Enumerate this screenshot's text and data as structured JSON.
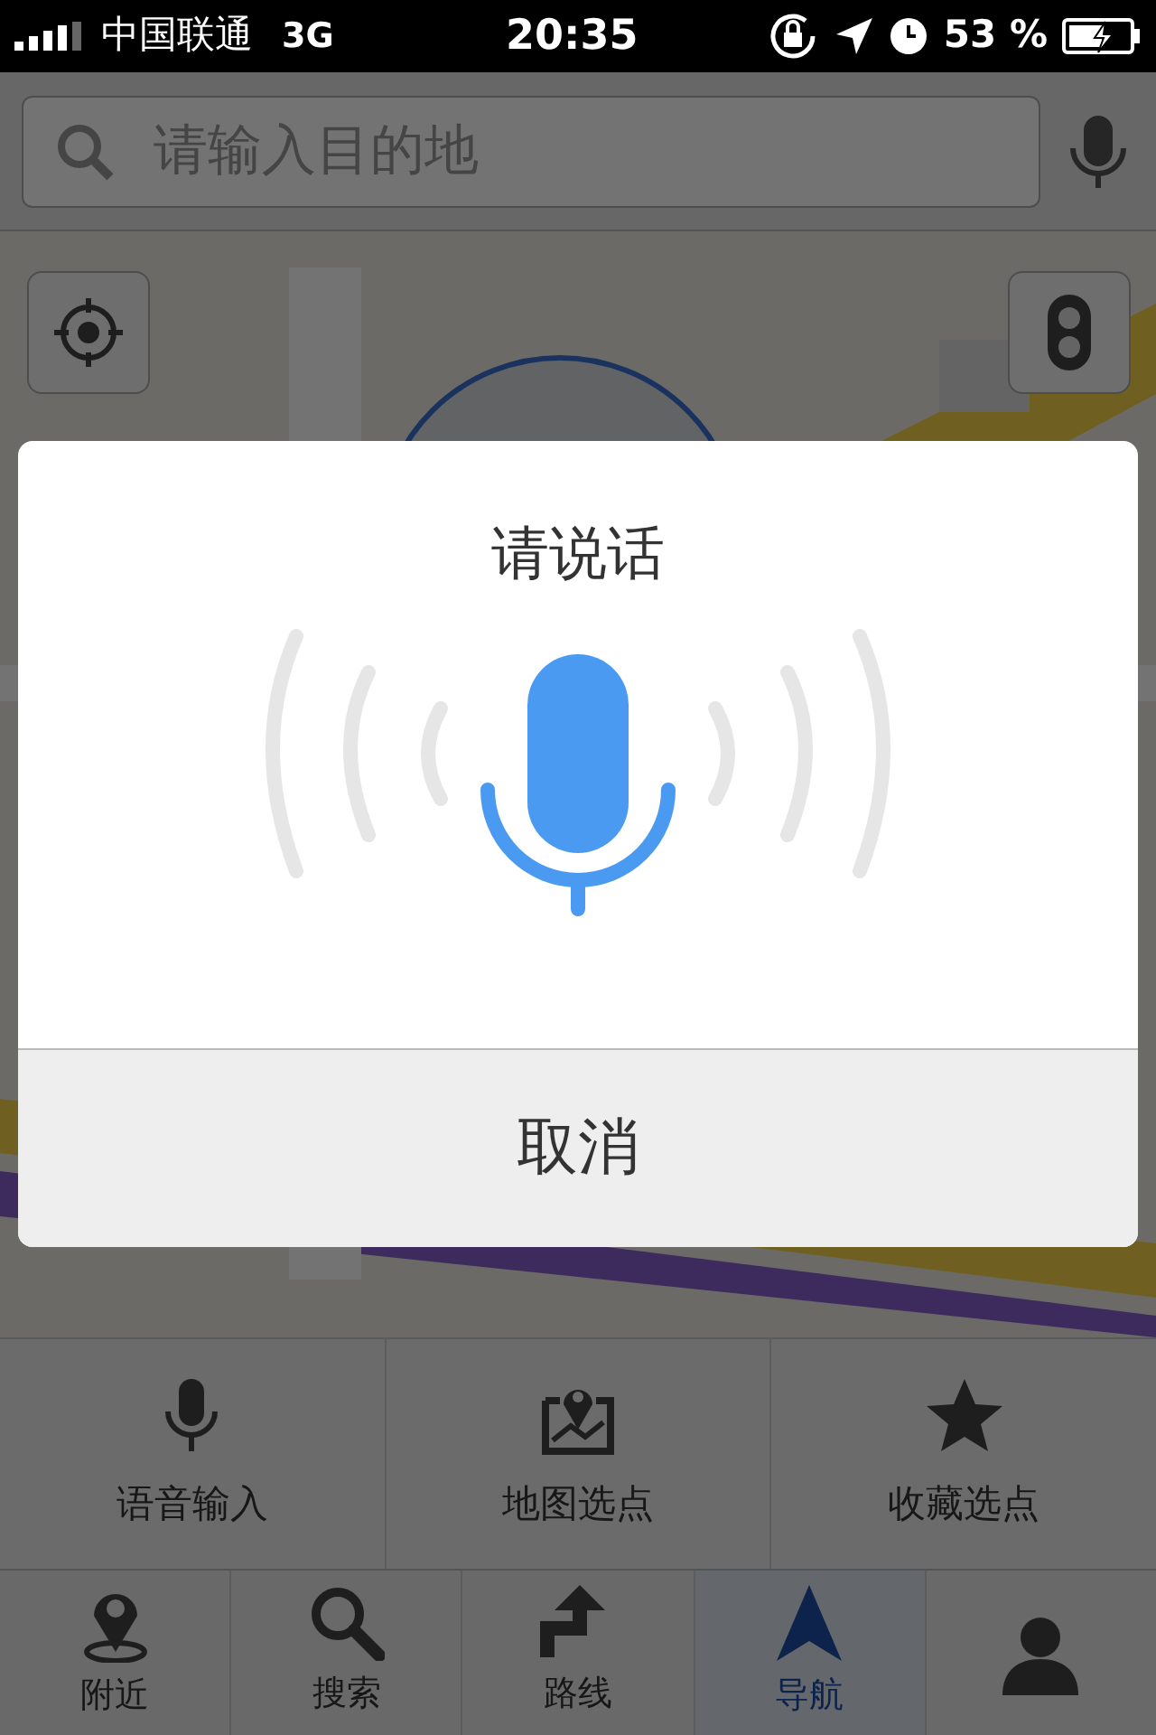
{
  "status_bar": {
    "carrier": "中国联通",
    "network": "3G",
    "time": "20:35",
    "battery": "53 %"
  },
  "search": {
    "placeholder": "请输入目的地"
  },
  "dialog": {
    "title": "请说话",
    "cancel": "取消"
  },
  "quick_actions": [
    {
      "label": "语音输入",
      "kind": "mic"
    },
    {
      "label": "地图选点",
      "kind": "map"
    },
    {
      "label": "收藏选点",
      "kind": "star"
    }
  ],
  "tabs": [
    {
      "label": "附近",
      "kind": "pin",
      "selected": false
    },
    {
      "label": "搜索",
      "kind": "search",
      "selected": false
    },
    {
      "label": "路线",
      "kind": "route",
      "selected": false
    },
    {
      "label": "导航",
      "kind": "nav",
      "selected": true
    },
    {
      "kind": "user",
      "selected": false
    }
  ]
}
